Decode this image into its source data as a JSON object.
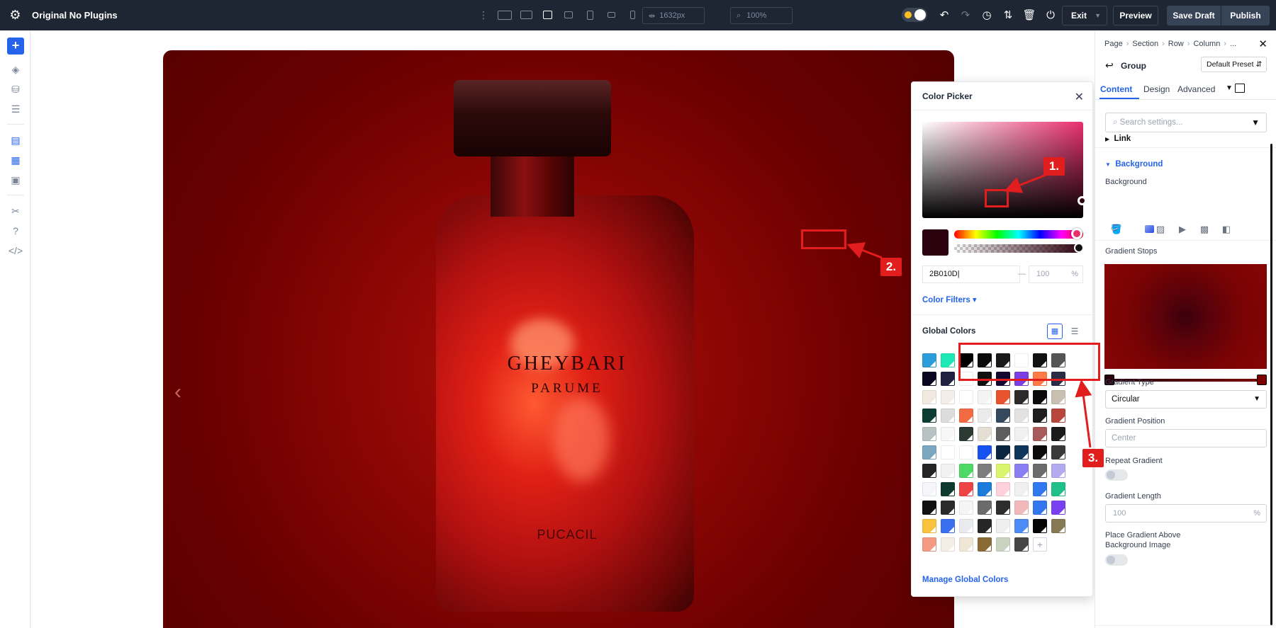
{
  "topbar": {
    "title": "Original No Plugins",
    "width_value": "1632px",
    "zoom_value": "100%",
    "exit_label": "Exit",
    "preview_label": "Preview",
    "save_draft_label": "Save Draft",
    "publish_label": "Publish",
    "bg_color": "#1e2633"
  },
  "hero": {
    "brand_line1": "GHEYBARI",
    "brand_line2": "PARUME",
    "brand_line3": "PUCACIL"
  },
  "color_picker": {
    "title": "Color Picker",
    "hex_value": "2B010D",
    "opacity_value": "100",
    "opacity_unit": "%",
    "opacity_dash": "—",
    "color_filters_label": "Color Filters ▾",
    "global_colors_label": "Global Colors",
    "manage_label": "Manage Global Colors",
    "selected_color": "#2b010d",
    "swatches": [
      "#2d9cdb",
      "#1de9b6",
      "#000000",
      "#0a0a0a",
      "#1a1a1a",
      "#ffffff",
      "#111111",
      "#555555",
      "#0b0420",
      "#1e2140",
      "#ffffff",
      "#101010",
      "#140830",
      "#7b3fe4",
      "#ff7a45",
      "#2a2b45",
      "#efe9df",
      "#f3eeea",
      "#ffffff",
      "#f4f4f5",
      "#e9542f",
      "#2a2a2a",
      "#0a0a0a",
      "#c9bfb3",
      "#0b3d33",
      "#dcdcdc",
      "#f36a43",
      "#ebebeb",
      "#34495e",
      "#e2e2e2",
      "#1d1d1d",
      "#b8463a",
      "#b9c2c2",
      "#f7f7f7",
      "#2b3a32",
      "#e4ded4",
      "#5d5d5d",
      "#f0f0f0",
      "#a95a5a",
      "#1a1a1a",
      "#7aa7bf",
      "#ffffff",
      "#ffffff",
      "#1652f0",
      "#0a2540",
      "#10355a",
      "#0b0b0b",
      "#3a3a3a",
      "#242424",
      "#f2f2f2",
      "#4cd964",
      "#7d7d7d",
      "#d9f56b",
      "#8a7ef2",
      "#6b6b6b",
      "#b3aaf0",
      "#f5f6fa",
      "#0e3b2e",
      "#ee4444",
      "#1a7bdc",
      "#ffd1dc",
      "#f0f0f0",
      "#2f78f0",
      "#1fc08a",
      "#111111",
      "#2a2a2a",
      "#f5f5f5",
      "#6b6b6b",
      "#2d2d2d",
      "#f1b9b9",
      "#3377ee",
      "#7a3ff0",
      "#f9c23c",
      "#3a6ff0",
      "#e9ebee",
      "#262626",
      "#efefef",
      "#4b8bf5",
      "#050505",
      "#867a55",
      "#f49a82",
      "#f3eee6",
      "#efe6d6",
      "#8a6a35",
      "#c9d3c0",
      "#454545"
    ]
  },
  "panel": {
    "breadcrumb": [
      "Page",
      "Section",
      "Row",
      "Column",
      "..."
    ],
    "group_label": "Group",
    "preset_label": "Default Preset",
    "tabs": [
      "Content",
      "Design",
      "Advanced"
    ],
    "search_placeholder": "Search settings...",
    "link_label": "Link",
    "background_section": "Background",
    "background_label": "Background",
    "gradient_stops_label": "Gradient Stops",
    "gradient_type_label": "Gradient Type",
    "gradient_type_value": "Circular",
    "gradient_position_label": "Gradient Position",
    "gradient_position_value": "Center",
    "repeat_gradient_label": "Repeat Gradient",
    "gradient_length_label": "Gradient Length",
    "gradient_length_value": "100",
    "gradient_length_unit": "%",
    "place_above_label_1": "Place Gradient Above",
    "place_above_label_2": "Background Image",
    "accent_color": "#2563eb"
  },
  "annotations": [
    "1.",
    "2.",
    "3."
  ]
}
